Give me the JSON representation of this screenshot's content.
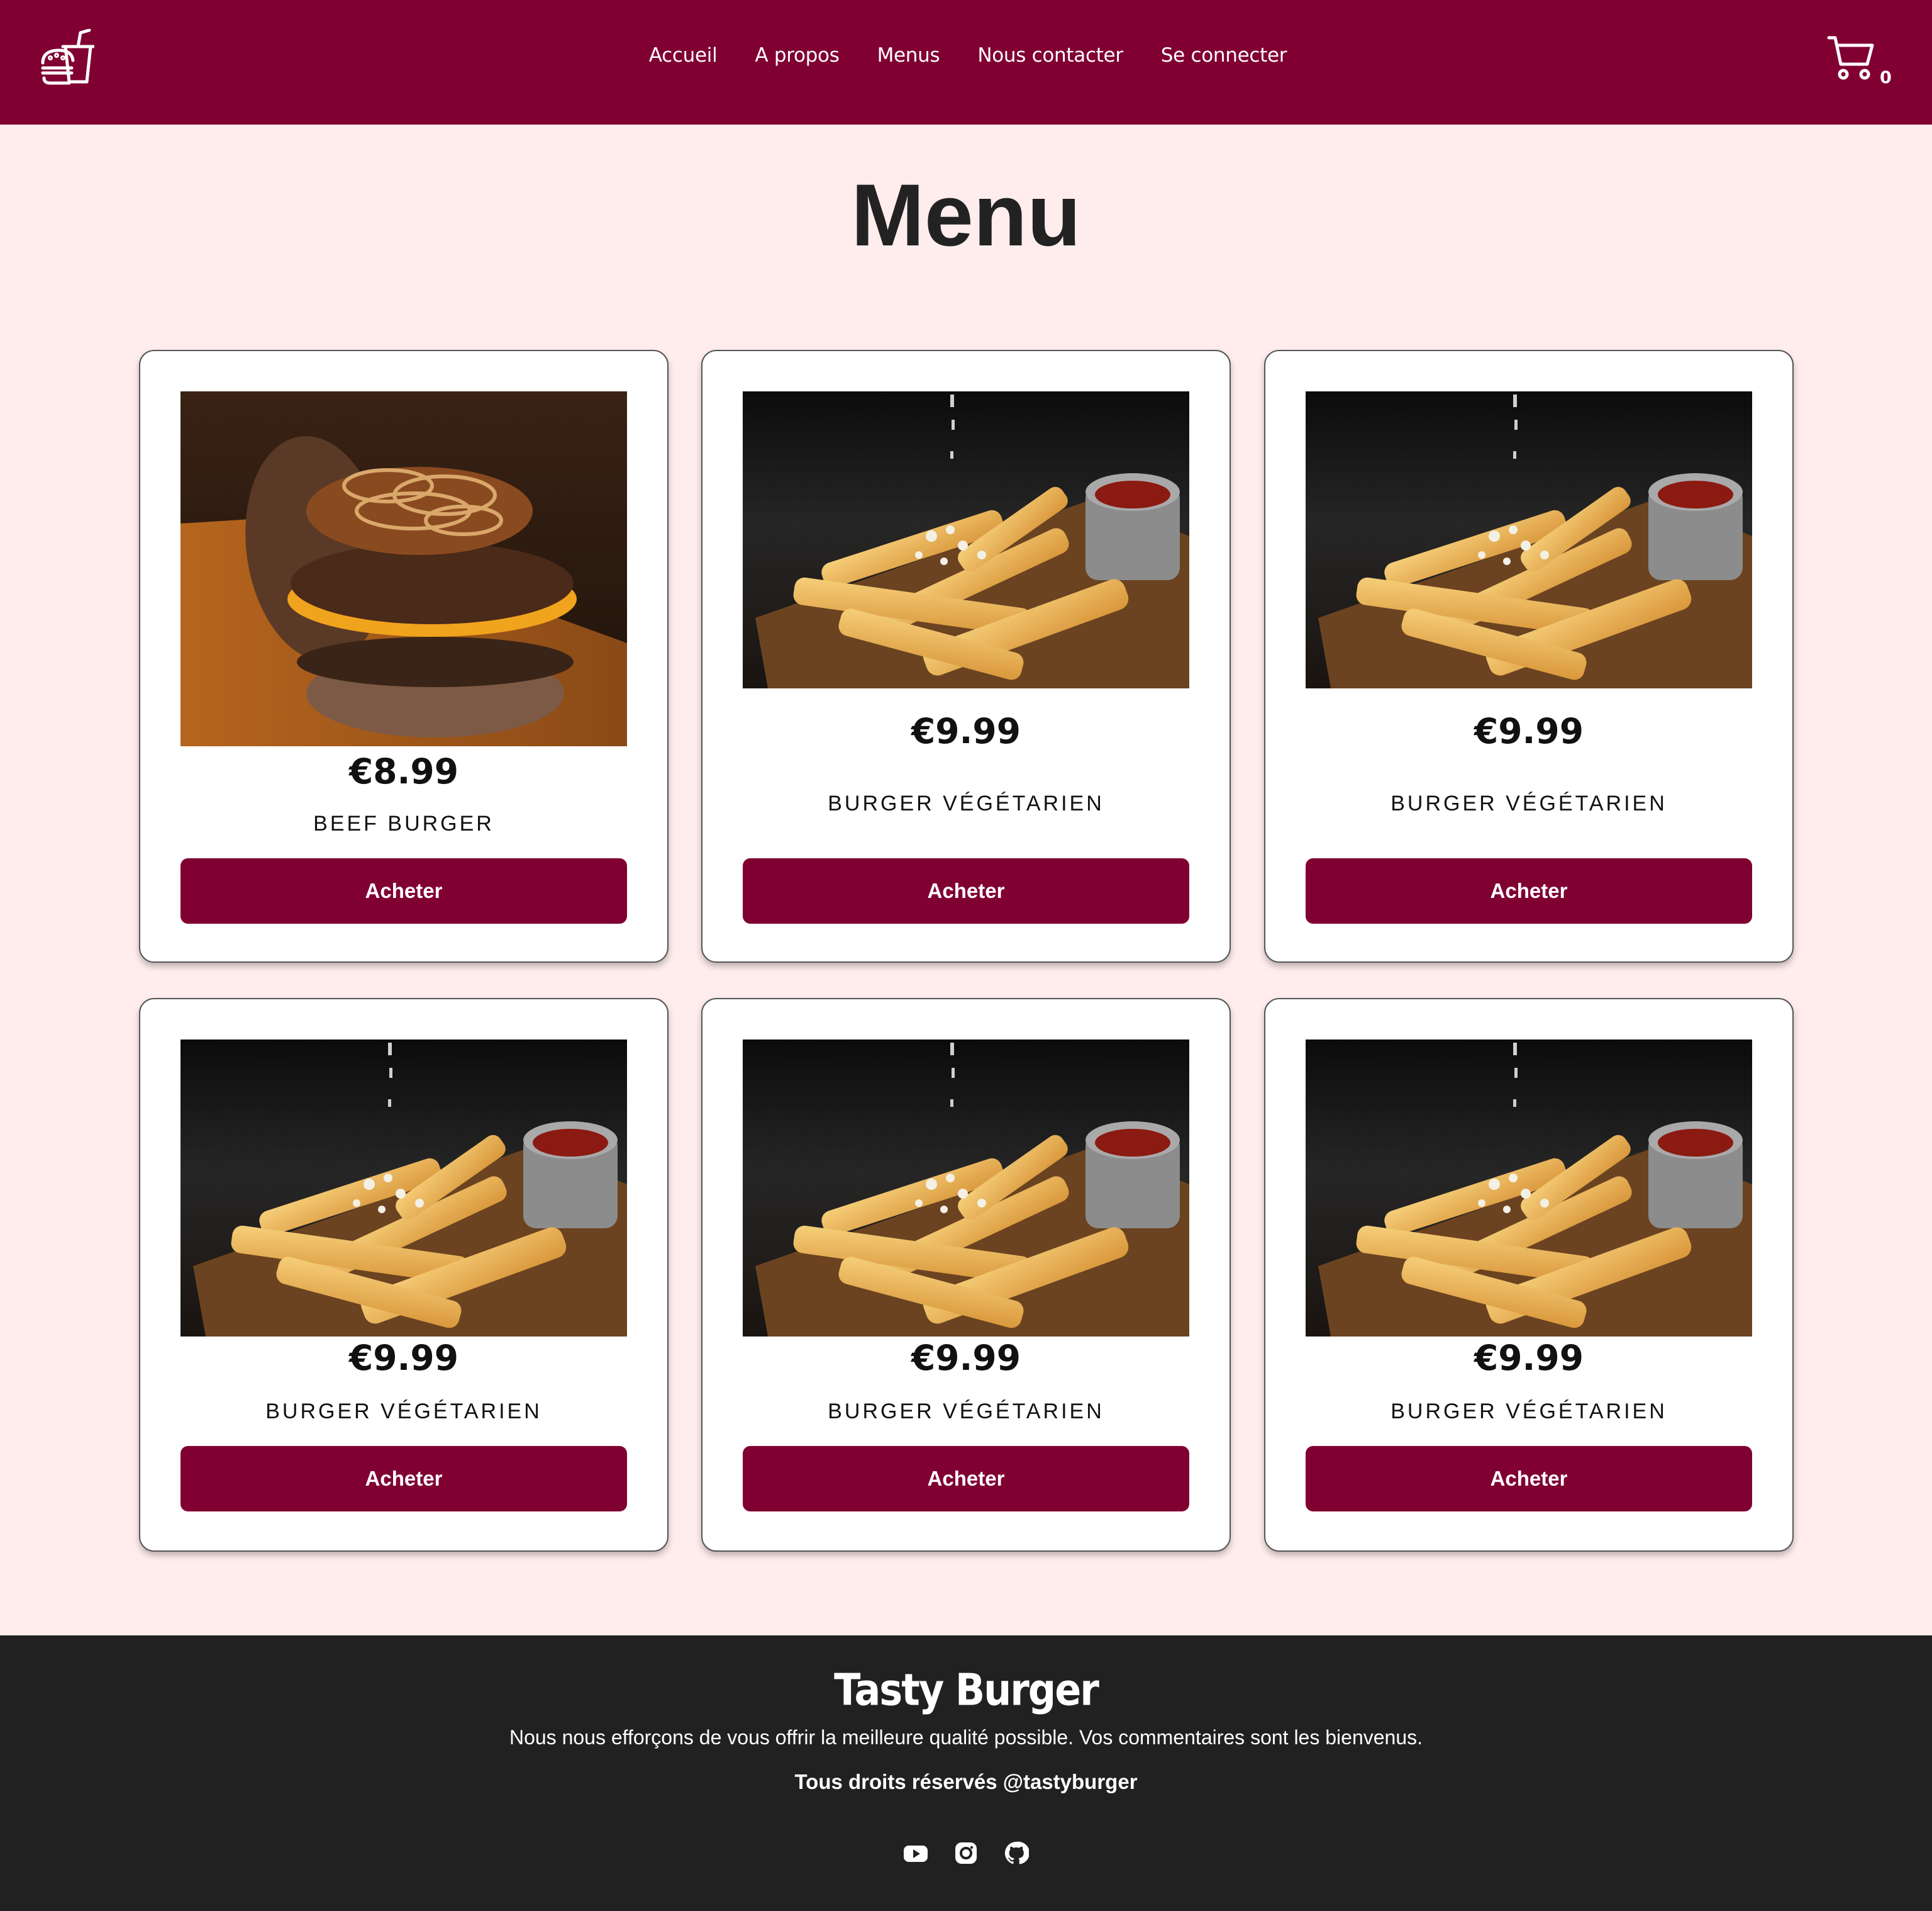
{
  "nav": {
    "links": [
      "Accueil",
      "A propos",
      "Menus",
      "Nous contacter",
      "Se connecter"
    ],
    "cart_count": "0"
  },
  "page": {
    "title": "Menu"
  },
  "menu_items": [
    {
      "price": "€8.99",
      "name": "BEEF BURGER",
      "button": "Acheter",
      "image": "beef-burger"
    },
    {
      "price": "€9.99",
      "name": "BURGER VÉGÉTARIEN",
      "button": "Acheter",
      "image": "fries"
    },
    {
      "price": "€9.99",
      "name": "BURGER VÉGÉTARIEN",
      "button": "Acheter",
      "image": "fries"
    },
    {
      "price": "€9.99",
      "name": "BURGER VÉGÉTARIEN",
      "button": "Acheter",
      "image": "fries"
    },
    {
      "price": "€9.99",
      "name": "BURGER VÉGÉTARIEN",
      "button": "Acheter",
      "image": "fries"
    },
    {
      "price": "€9.99",
      "name": "BURGER VÉGÉTARIEN",
      "button": "Acheter",
      "image": "fries"
    }
  ],
  "footer": {
    "brand": "Tasty Burger",
    "tagline": "Nous nous efforçons de vous offrir la meilleure qualité possible. Vos commentaires sont les bienvenus.",
    "rights": "Tous droits réservés @tastyburger",
    "social": [
      "youtube-icon",
      "instagram-icon",
      "github-icon"
    ]
  },
  "colors": {
    "primary": "#800032",
    "background": "#ffeded",
    "footer": "#212121"
  }
}
